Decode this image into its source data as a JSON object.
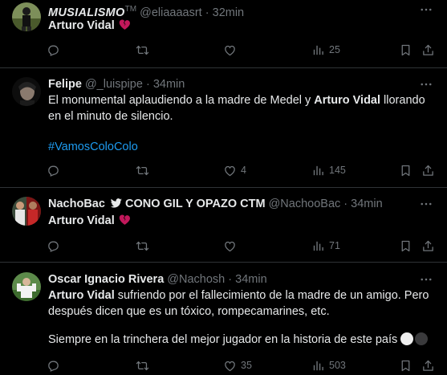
{
  "tweets": [
    {
      "name": "MUSIALISMO",
      "name_suffix": "TM",
      "handle": "@eliaaaasrt",
      "dot": "·",
      "time": "32min",
      "text_bold": "Arturo Vidal",
      "text_rest": "",
      "emoji": "broken-heart",
      "replies": "",
      "retweets": "",
      "likes": "",
      "views": "25"
    },
    {
      "name": "Felipe",
      "handle": "@_luispipe",
      "dot": "·",
      "time": "34min",
      "text_a": "El monumental aplaudiendo a la madre de Medel y ",
      "text_bold": "Arturo Vidal",
      "text_b": " llorando en el minuto de silencio.",
      "hashtag": "#VamosColoColo",
      "replies": "",
      "retweets": "",
      "likes": "4",
      "views": "145"
    },
    {
      "name": "NachoBac",
      "name_suffix": "CONO GIL Y OPAZO CTM",
      "handle": "@NachooBac",
      "dot": "·",
      "time": "34min",
      "text_bold": "Arturo Vidal",
      "emoji": "broken-heart",
      "replies": "",
      "retweets": "",
      "likes": "",
      "views": "71"
    },
    {
      "name": "Oscar Ignacio Rivera",
      "handle": "@Nachosh",
      "dot": "·",
      "time": "34min",
      "text_bold": "Arturo Vidal",
      "text_a": " sufriendo por el fallecimiento de la madre de un amigo. Pero después dicen que es un tóxico, rompecamarines, etc.",
      "text_c": "Siempre en la trinchera del mejor jugador en la historia de este país",
      "replies": "",
      "retweets": "",
      "likes": "35",
      "views": "503"
    }
  ],
  "colors": {
    "background": "#000000",
    "text": "#e7e9ea",
    "muted": "#71767b",
    "divider": "#2f3336",
    "link": "#1d9bf0",
    "broken_heart": "#c2185b"
  },
  "icons": [
    "reply-icon",
    "retweet-icon",
    "like-icon",
    "views-icon",
    "bookmark-icon",
    "share-icon",
    "more-icon",
    "broken-heart-emoji",
    "bird-icon"
  ]
}
